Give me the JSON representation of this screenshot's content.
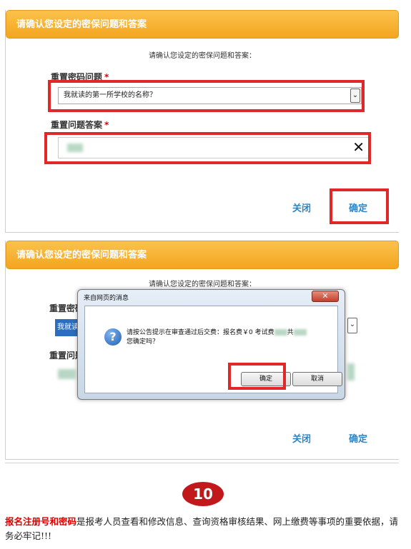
{
  "panel1": {
    "header": "请确认您设定的密保问题和答案",
    "prompt": "请确认您设定的密保问题和答案：",
    "question_label": "重置密码问题",
    "answer_label": "重置问题答案",
    "required_mark": "*",
    "question_value": "我就读的第一所学校的名称？",
    "chevron": "⌄",
    "clear_icon": "✕",
    "close_label": "关闭",
    "confirm_label": "确定"
  },
  "panel2": {
    "header": "请确认您设定的密保问题和答案",
    "prompt": "请确认您设定的密保问题和答案：",
    "question_label_partial": "重置密码",
    "answer_label_partial": "重置问题",
    "select_partial": "我就读",
    "close_label": "关闭",
    "confirm_label": "确定"
  },
  "dialog": {
    "title": "来自网页的消息",
    "close": "✕",
    "icon": "?",
    "message_part1": "请按公告提示在审查通过后交费：报名费￥0 考试费",
    "message_part2": "共",
    "message_line2": "您确定吗？",
    "ok_label": "确定",
    "cancel_label": "取消"
  },
  "step_number": "10",
  "note": {
    "highlight": "报名注册号和密码",
    "text": "是报考人员查看和修改信息、查询资格审核结果、网上缴费等事项的重要依据，请务必牢记!!!"
  }
}
